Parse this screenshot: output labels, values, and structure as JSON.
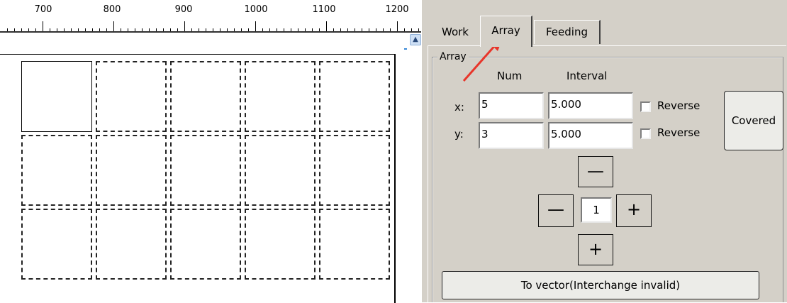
{
  "ruler": {
    "labels": [
      "700",
      "800",
      "900",
      "1000",
      "1100",
      "1200"
    ]
  },
  "canvas": {
    "array_columns": 5,
    "array_rows": 3
  },
  "tabs": [
    {
      "label": "Work",
      "selected": false
    },
    {
      "label": "Array",
      "selected": true
    },
    {
      "label": "Feeding",
      "selected": false
    }
  ],
  "array_group": {
    "title": "Array",
    "col_num": "Num",
    "col_interval": "Interval",
    "x_label": "x:",
    "y_label": "y:",
    "x_num": "5",
    "x_interval": "5.000",
    "y_num": "3",
    "y_interval": "5.000",
    "reverse_label": "Reverse",
    "x_reverse_checked": false,
    "y_reverse_checked": false,
    "covered_label": "Covered",
    "step_value": "1",
    "minus_glyph": "—",
    "plus_glyph": "+",
    "to_vector_label": "To vector(Interchange invalid)"
  },
  "colors": {
    "panel_bg": "#d4d0c8",
    "annotation_arrow": "#e8352a"
  },
  "icons": {
    "scroll_up": "chevron-up-icon"
  }
}
